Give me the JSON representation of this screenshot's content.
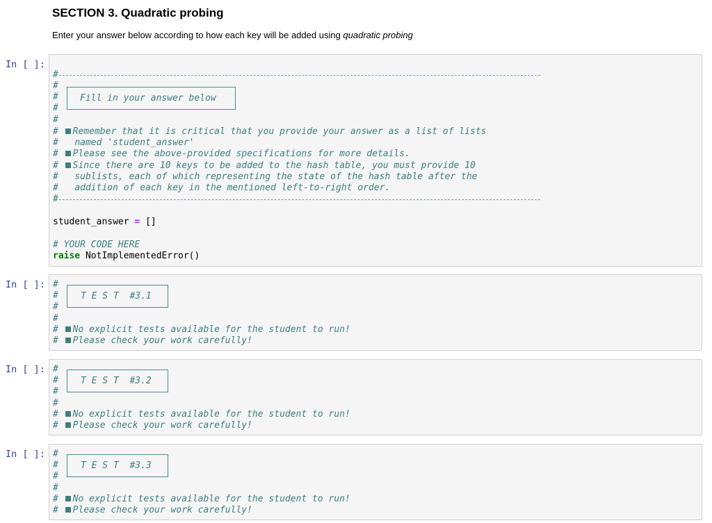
{
  "section": {
    "title": "SECTION 3. Quadratic probing",
    "intro_prefix": "Enter your answer below according to how each key will be added using ",
    "intro_emphasis": "quadratic probing"
  },
  "cells": [
    {
      "prompt": "In [ ]:",
      "box_label": "Fill in your answer below",
      "hash": "#",
      "rule_prefix": "#",
      "notes": [
        {
          "bullet": true,
          "text": "Remember that it is critical that you provide your answer as a list of lists"
        },
        {
          "bullet": false,
          "text": "named 'student_answer'"
        },
        {
          "bullet": true,
          "text": "Please see the above-provided specifications for more details."
        },
        {
          "bullet": true,
          "text": "Since there are 10 keys to be added to the hash table, you must provide 10"
        },
        {
          "bullet": false,
          "text": "sublists, each of which representing the state of the hash table after the"
        },
        {
          "bullet": false,
          "text": "addition of each key in the mentioned left-to-right order."
        }
      ],
      "code": {
        "var": "student_answer",
        "op": "=",
        "value": "[]",
        "comment": "# YOUR CODE HERE",
        "keyword": "raise",
        "call": "NotImplementedError()"
      }
    },
    {
      "prompt": "In [ ]:",
      "box_label": "T E S T  #3.1",
      "hash": "#",
      "notes": [
        {
          "bullet": true,
          "text": "No explicit tests available for the student to run!"
        },
        {
          "bullet": true,
          "text": "Please check your work carefully!"
        }
      ]
    },
    {
      "prompt": "In [ ]:",
      "box_label": "T E S T  #3.2",
      "hash": "#",
      "notes": [
        {
          "bullet": true,
          "text": "No explicit tests available for the student to run!"
        },
        {
          "bullet": true,
          "text": "Please check your work carefully!"
        }
      ]
    },
    {
      "prompt": "In [ ]:",
      "box_label": "T E S T  #3.3",
      "hash": "#",
      "notes": [
        {
          "bullet": true,
          "text": "No explicit tests available for the student to run!"
        },
        {
          "bullet": true,
          "text": "Please check your work carefully!"
        }
      ]
    }
  ],
  "colors": {
    "prompt": "#303f9f",
    "comment": "#3d7e7e",
    "keyword": "#008000",
    "operator": "#aa22ff",
    "cell_bg": "#f5f5f5"
  }
}
